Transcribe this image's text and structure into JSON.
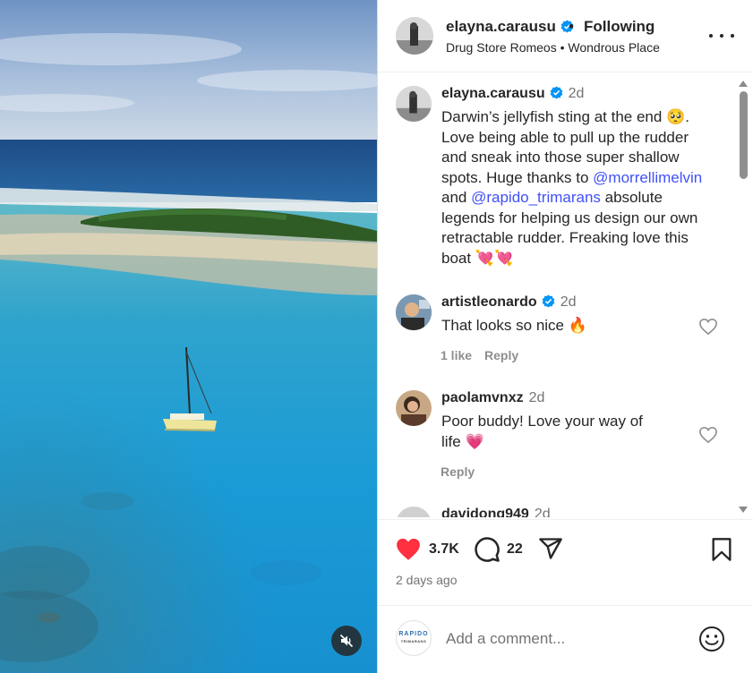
{
  "post": {
    "username": "elayna.carausu",
    "following_label": "Following",
    "separator": "•",
    "subline": "Drug Store Romeos • Wondrous Place",
    "more_icon": "more-horizontal-icon"
  },
  "caption": {
    "username": "elayna.carausu",
    "time": "2d",
    "text_1": "Darwin’s jellyfish sting at the end 🥺.",
    "text_2": "Love being able to pull up the rudder",
    "text_3": "and sneak into those super shallow",
    "text_4": "spots. Huge thanks to ",
    "mention_1": "@morrellimelvin",
    "text_5": "and ",
    "mention_2": "@rapido_trimarans",
    "text_6": " absolute",
    "text_7": "legends for helping us design our own",
    "text_8": "retractable rudder. Freaking love this",
    "text_9": "boat 💘💘"
  },
  "comments": [
    {
      "username": "artistleonardo",
      "time": "2d",
      "text": "That looks so nice 🔥",
      "likes": "1 like",
      "reply": "Reply"
    },
    {
      "username": "paolamvnxz",
      "time": "2d",
      "text_1": "Poor buddy! Love your way of",
      "text_2": "life 💗",
      "reply": "Reply"
    },
    {
      "username": "davidong949",
      "time": "2d"
    }
  ],
  "actions": {
    "like_count": "3.7K",
    "comment_count": "22",
    "time_ago": "2 days ago"
  },
  "add_comment": {
    "placeholder": "Add a comment...",
    "brand_text": "RAPIDO",
    "brand_sub": "TRIMARANS"
  },
  "colors": {
    "accent_link": "#4150f7",
    "verified": "#0095f6",
    "like_red": "#ff3040",
    "text_muted": "#737373"
  }
}
